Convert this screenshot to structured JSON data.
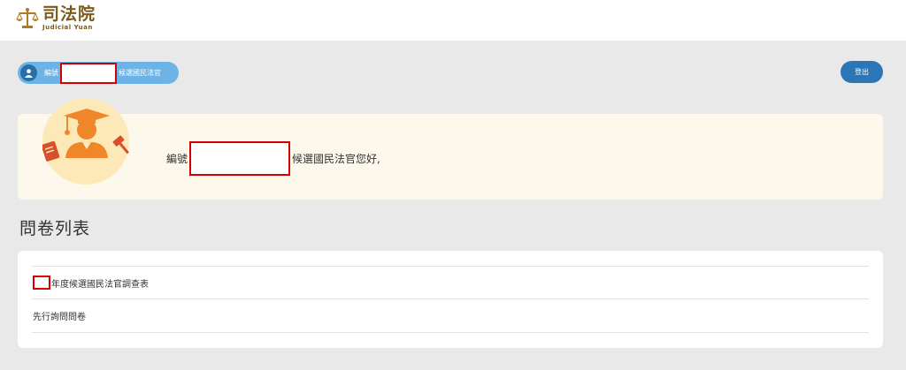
{
  "header": {
    "logo_cn": "司法院",
    "logo_en": "Judicial Yuan"
  },
  "user": {
    "prefix": "編號",
    "suffix": "候選國民法官",
    "logout_label": "登出"
  },
  "welcome": {
    "prefix": "編號",
    "suffix": "候選國民法官您好,"
  },
  "section": {
    "title": "問卷列表"
  },
  "surveys": [
    {
      "label": "年度候選國民法官調查表"
    },
    {
      "label": "先行詢問問卷"
    }
  ],
  "colors": {
    "pill": "#6db3e6",
    "button": "#2a76b6",
    "accent_orange": "#f0862a",
    "redact": "#d40000"
  }
}
